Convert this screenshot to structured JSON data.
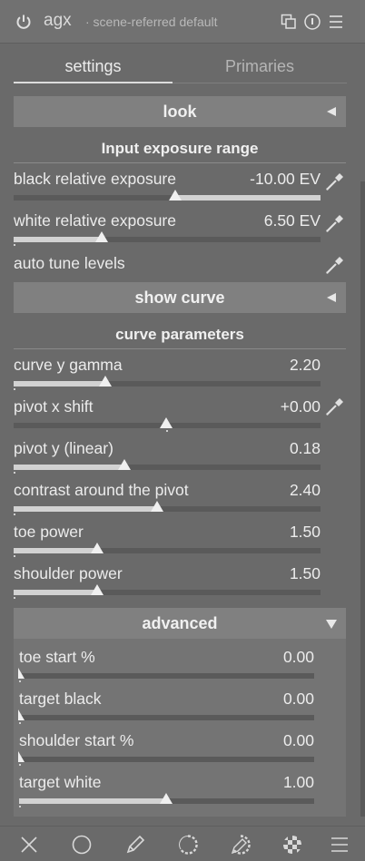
{
  "header": {
    "module_name": "agx",
    "preset": "· scene-referred default",
    "icons": [
      "power-icon",
      "multi-instance-icon",
      "reset-icon",
      "presets-menu-icon"
    ]
  },
  "tabs": [
    {
      "label": "settings",
      "active": true
    },
    {
      "label": "Primaries",
      "active": false
    }
  ],
  "look": {
    "label": "look",
    "expanded": false
  },
  "input_exposure": {
    "title": "Input exposure range",
    "black": {
      "label": "black relative exposure",
      "value": "-10.00 EV",
      "position": 0.52
    },
    "white": {
      "label": "white relative exposure",
      "value": "6.50 EV",
      "position": 0.285
    },
    "auto_tune": {
      "label": "auto tune levels"
    }
  },
  "show_curve": {
    "label": "show curve",
    "expanded": false
  },
  "curve_parameters": {
    "title": "curve parameters",
    "gamma": {
      "label": "curve y gamma",
      "value": "2.20",
      "position": 0.295
    },
    "pivot_x": {
      "label": "pivot x shift",
      "value": "+0.00",
      "position": 0.5
    },
    "pivot_y": {
      "label": "pivot y (linear)",
      "value": "0.18",
      "position": 0.36
    },
    "contrast": {
      "label": "contrast around the pivot",
      "value": "2.40",
      "position": 0.465
    },
    "toe_power": {
      "label": "toe power",
      "value": "1.50",
      "position": 0.27
    },
    "shoulder_power": {
      "label": "shoulder power",
      "value": "1.50",
      "position": 0.27
    }
  },
  "advanced": {
    "label": "advanced",
    "expanded": true,
    "toe_start": {
      "label": "toe start %",
      "value": "0.00",
      "position": 0.0
    },
    "target_black": {
      "label": "target black",
      "value": "0.00",
      "position": 0.0
    },
    "shoulder_start": {
      "label": "shoulder start %",
      "value": "0.00",
      "position": 0.0
    },
    "target_white": {
      "label": "target white",
      "value": "1.00",
      "position": 0.5
    }
  },
  "bottom_toolbar": {
    "icons": [
      "close-icon",
      "circle-icon",
      "pencil-icon",
      "parametric-mask-icon",
      "drawn-parametric-mask-icon",
      "raster-mask-icon",
      "menu-icon"
    ]
  },
  "colors": {
    "accent": "#d2d2d2",
    "background": "#6a6a6a",
    "section_bar": "#808080"
  }
}
